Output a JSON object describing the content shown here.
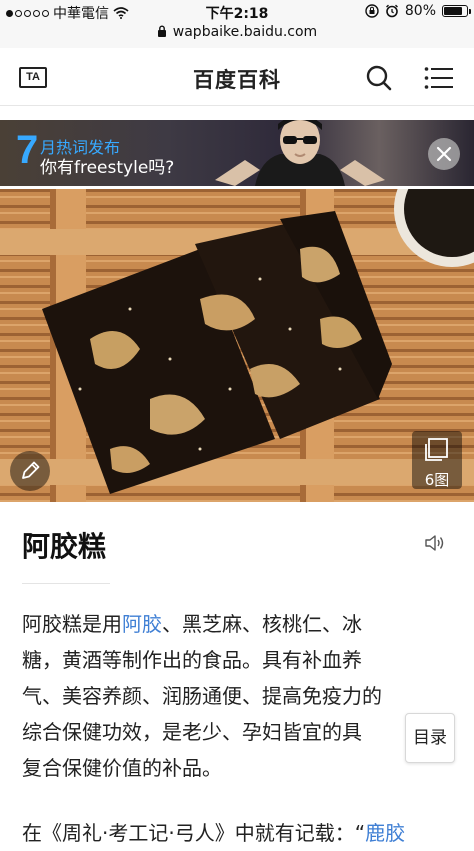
{
  "status_bar": {
    "carrier": "中華電信",
    "time": "下午2:18",
    "battery_percent": "80%",
    "battery_level": 0.8
  },
  "url_bar": {
    "url": "wapbaike.baidu.com"
  },
  "header": {
    "ta_label": "TA",
    "title": "百度百科"
  },
  "banner": {
    "number": "7",
    "line1": "月热词发布",
    "line2": "你有freestyle吗?"
  },
  "hero": {
    "gallery_count": "6图"
  },
  "entry": {
    "title": "阿胶糕"
  },
  "paragraph1": {
    "line1_pre": "阿胶糕是用",
    "line1_link": "阿胶",
    "line1_post": "、黑芝麻、核桃仁、冰",
    "line2": "糖，黄酒等制作出的食品。具有补血养",
    "line3": "气、美容养颜、润肠通便、提高免疫力的",
    "line4": "综合保健功效，是老少、孕妇皆宜的具",
    "line5": "复合保健价值的补品。"
  },
  "paragraph2": {
    "text": "在《周礼·考工记·弓人》中就有记载：“",
    "link": "鹿胶"
  },
  "toc": {
    "label": "目录"
  },
  "colors": {
    "link": "#3f7fd4",
    "banner_accent": "#37a9ff"
  }
}
